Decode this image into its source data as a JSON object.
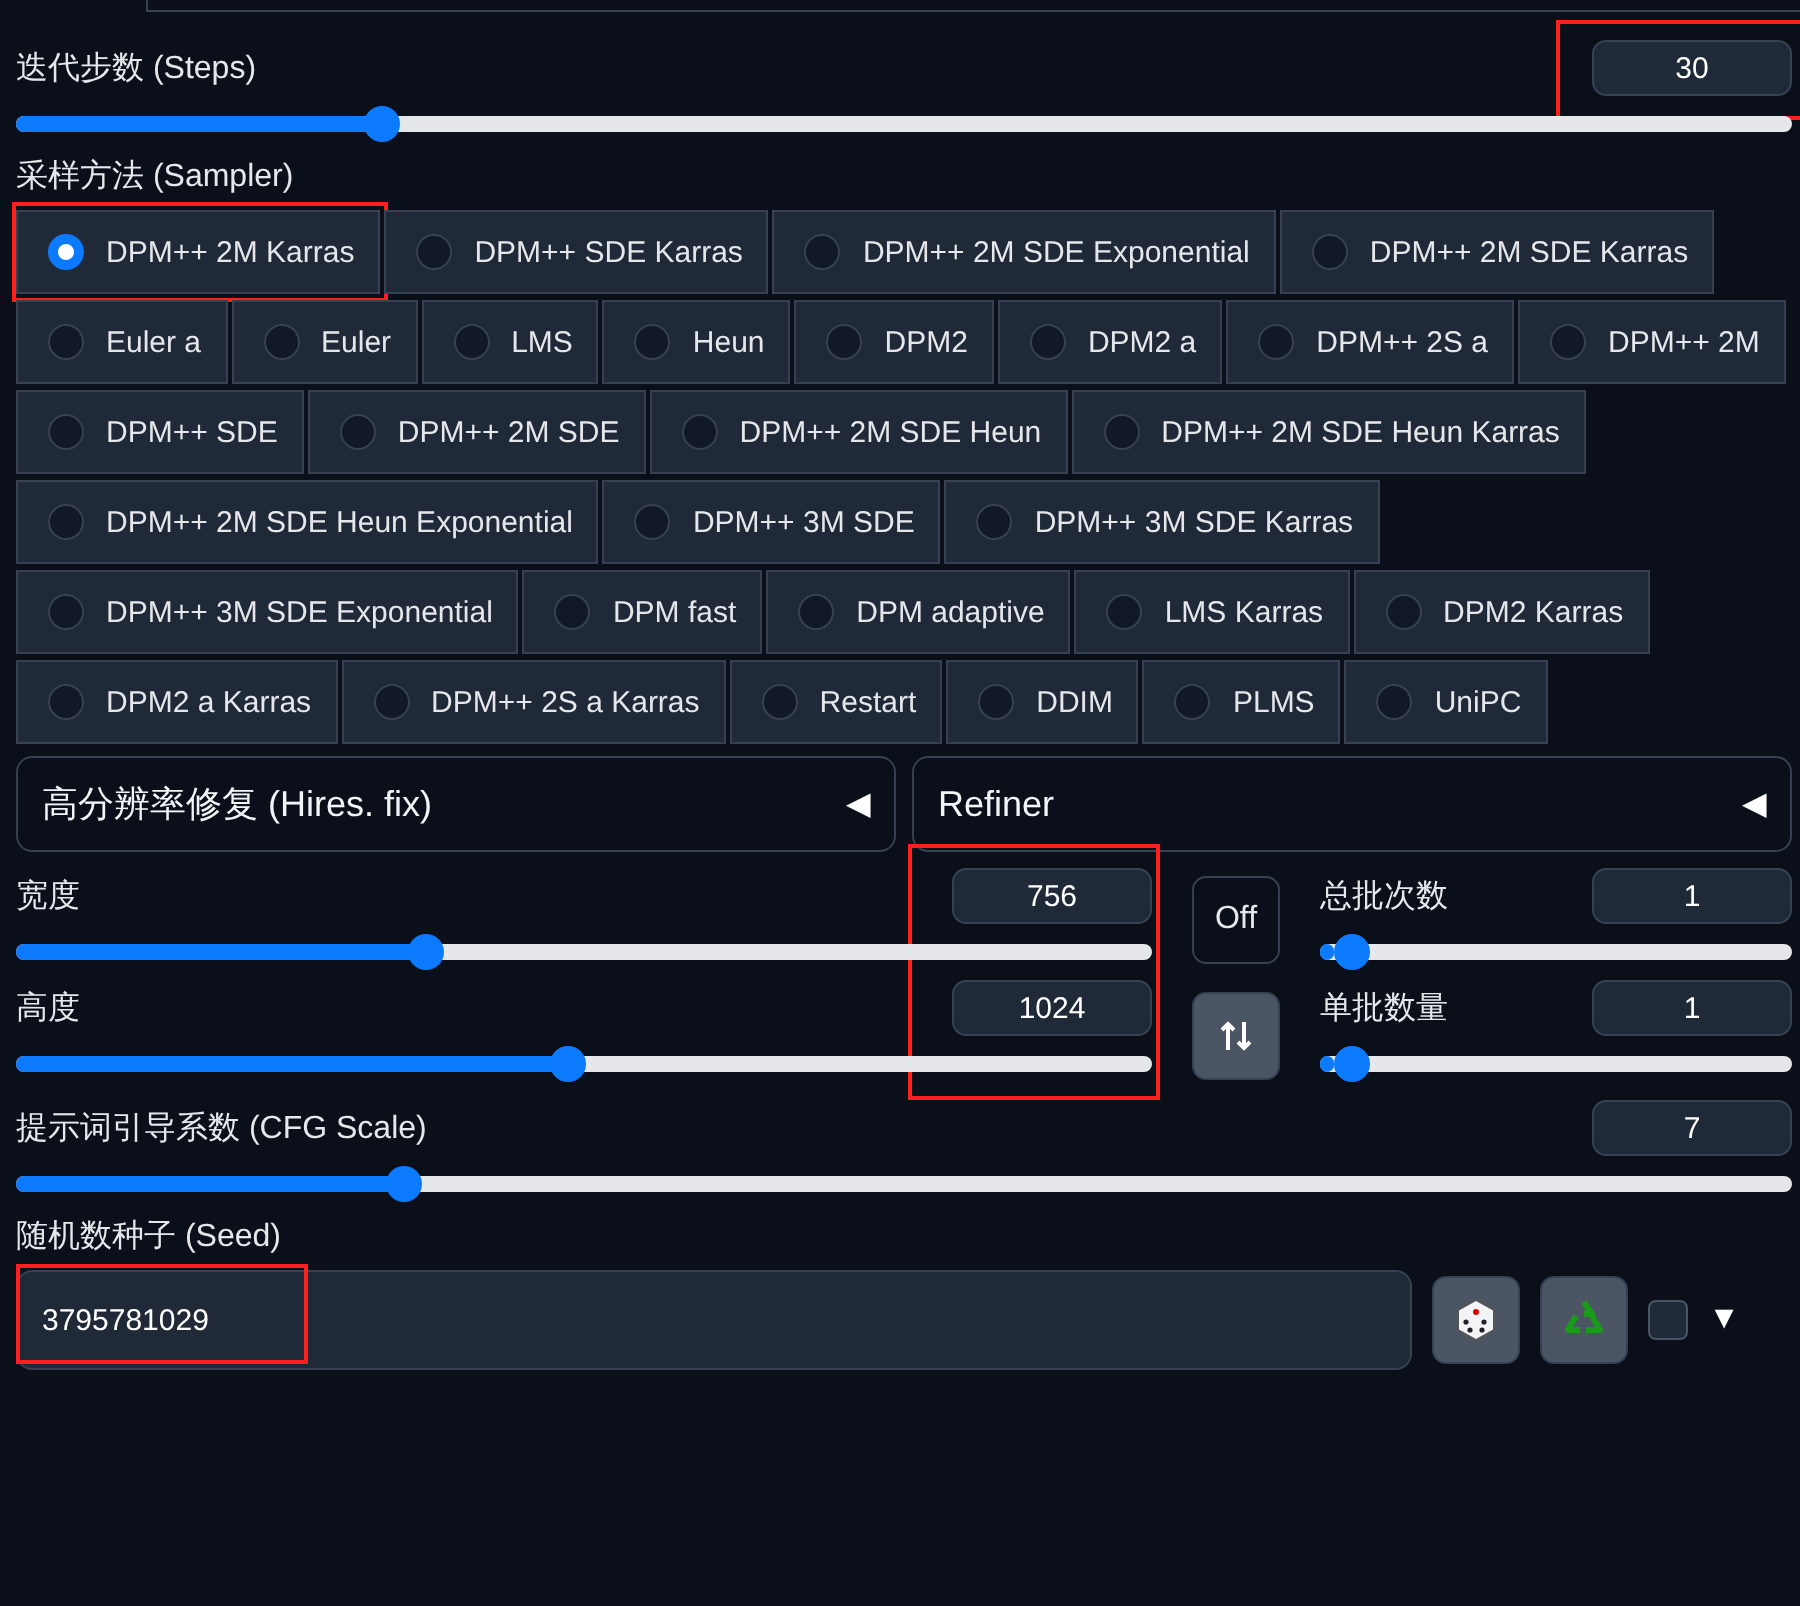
{
  "steps": {
    "label": "迭代步数 (Steps)",
    "value": "30",
    "level": 0.2,
    "highlighted": true
  },
  "sampler": {
    "label": "采样方法 (Sampler)",
    "options": [
      {
        "label": "DPM++ 2M Karras",
        "selected": true,
        "highlighted": true
      },
      {
        "label": "DPM++ SDE Karras",
        "selected": false,
        "highlighted": false
      },
      {
        "label": "DPM++ 2M SDE Exponential",
        "selected": false,
        "highlighted": false
      },
      {
        "label": "DPM++ 2M SDE Karras",
        "selected": false,
        "highlighted": false
      },
      {
        "label": "Euler a",
        "selected": false,
        "highlighted": false
      },
      {
        "label": "Euler",
        "selected": false,
        "highlighted": false
      },
      {
        "label": "LMS",
        "selected": false,
        "highlighted": false
      },
      {
        "label": "Heun",
        "selected": false,
        "highlighted": false
      },
      {
        "label": "DPM2",
        "selected": false,
        "highlighted": false
      },
      {
        "label": "DPM2 a",
        "selected": false,
        "highlighted": false
      },
      {
        "label": "DPM++ 2S a",
        "selected": false,
        "highlighted": false
      },
      {
        "label": "DPM++ 2M",
        "selected": false,
        "highlighted": false
      },
      {
        "label": "DPM++ SDE",
        "selected": false,
        "highlighted": false
      },
      {
        "label": "DPM++ 2M SDE",
        "selected": false,
        "highlighted": false
      },
      {
        "label": "DPM++ 2M SDE Heun",
        "selected": false,
        "highlighted": false
      },
      {
        "label": "DPM++ 2M SDE Heun Karras",
        "selected": false,
        "highlighted": false
      },
      {
        "label": "DPM++ 2M SDE Heun Exponential",
        "selected": false,
        "highlighted": false
      },
      {
        "label": "DPM++ 3M SDE",
        "selected": false,
        "highlighted": false
      },
      {
        "label": "DPM++ 3M SDE Karras",
        "selected": false,
        "highlighted": false
      },
      {
        "label": "DPM++ 3M SDE Exponential",
        "selected": false,
        "highlighted": false
      },
      {
        "label": "DPM fast",
        "selected": false,
        "highlighted": false
      },
      {
        "label": "DPM adaptive",
        "selected": false,
        "highlighted": false
      },
      {
        "label": "LMS Karras",
        "selected": false,
        "highlighted": false
      },
      {
        "label": "DPM2 Karras",
        "selected": false,
        "highlighted": false
      },
      {
        "label": "DPM2 a Karras",
        "selected": false,
        "highlighted": false
      },
      {
        "label": "DPM++ 2S a Karras",
        "selected": false,
        "highlighted": false
      },
      {
        "label": "Restart",
        "selected": false,
        "highlighted": false
      },
      {
        "label": "DDIM",
        "selected": false,
        "highlighted": false
      },
      {
        "label": "PLMS",
        "selected": false,
        "highlighted": false
      },
      {
        "label": "UniPC",
        "selected": false,
        "highlighted": false
      }
    ]
  },
  "accordions": [
    {
      "label": "高分辨率修复 (Hires. fix)",
      "toggle": "◀",
      "expanded": false
    },
    {
      "label": "Refiner",
      "toggle": "◀",
      "expanded": false
    }
  ],
  "size": {
    "width": {
      "label": "宽度",
      "value": "756",
      "level": 0.357
    },
    "height": {
      "label": "高度",
      "value": "1024",
      "level": 0.486
    },
    "highlighted": true,
    "off_button": "Off"
  },
  "batch": [
    {
      "label": "总批次数",
      "value": "1",
      "level": 0.03
    },
    {
      "label": "单批数量",
      "value": "1",
      "level": 0.03
    }
  ],
  "cfg": {
    "label": "提示词引导系数 (CFG Scale)",
    "value": "7",
    "level": 0.213
  },
  "seed": {
    "label": "随机数种子 (Seed)",
    "value": "3795781029",
    "highlighted": true,
    "extra_checked": false,
    "extra_toggle": "▼"
  }
}
